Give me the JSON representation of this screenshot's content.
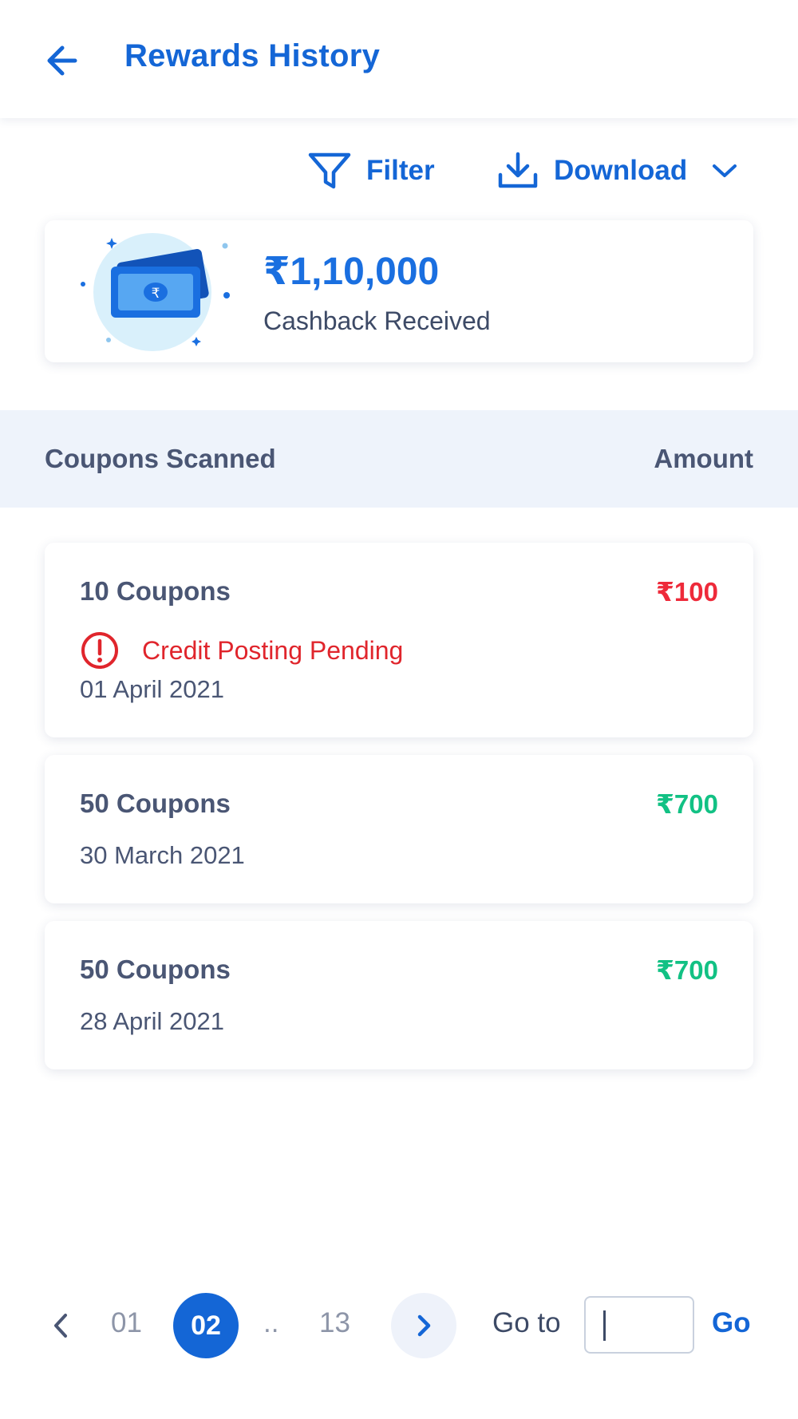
{
  "header": {
    "title": "Rewards History",
    "back_icon": "arrow-left-icon"
  },
  "toolbar": {
    "filter_label": "Filter",
    "download_label": "Download"
  },
  "summary": {
    "amount": "₹1,10,000",
    "label": "Cashback Received"
  },
  "table": {
    "col_left": "Coupons Scanned",
    "col_right": "Amount",
    "rows": [
      {
        "title": "10 Coupons",
        "amount": "₹100",
        "amount_color": "#ee2a3a",
        "status": "Credit Posting Pending",
        "date": "01 April 2021"
      },
      {
        "title": "50 Coupons",
        "amount": "₹700",
        "amount_color": "#12c184",
        "date": "30 March 2021"
      },
      {
        "title": "50 Coupons",
        "amount": "₹700",
        "amount_color": "#12c184",
        "date": "28 April 2021"
      }
    ]
  },
  "pagination": {
    "pages": [
      "01",
      "02",
      "13"
    ],
    "current": "02",
    "ellipsis": "..",
    "goto_label": "Go to",
    "goto_value": "",
    "go_label": "Go"
  },
  "colors": {
    "accent": "#1466d6",
    "pending": "#e0252c",
    "success": "#12c184",
    "header_band": "#eef3fb"
  }
}
